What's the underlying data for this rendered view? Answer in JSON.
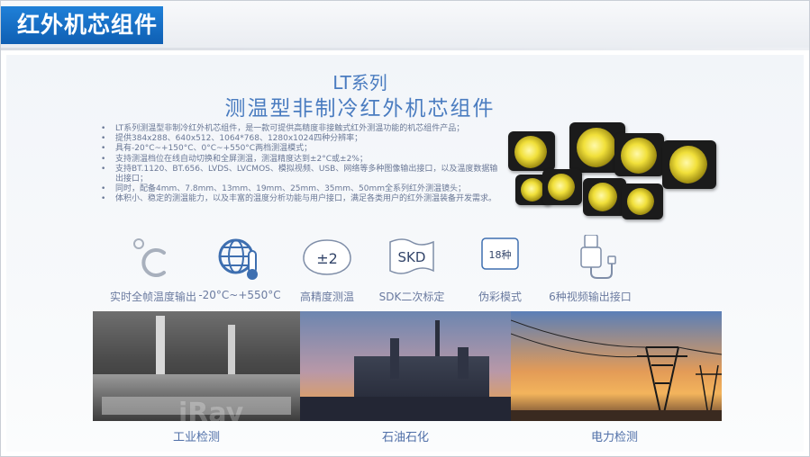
{
  "header": {
    "title": "红外机芯组件"
  },
  "heading": {
    "line1": "LT系列",
    "line2": "测温型非制冷红外机芯组件"
  },
  "bullets": [
    "LT系列测温型非制冷红外机芯组件，是一款可提供高精度非接触式红外测温功能的机芯组件产品；",
    "提供384x288、640x512、1064*768、1280x1024四种分辨率；",
    "具有-20°C~+150°C、0°C~+550°C两档测温模式；",
    "支持测温档位在线自动切换和全屏测温，测温精度达到±2°C或±2%；",
    "支持BT.1120、BT.656、LVDS、LVCMOS、模拟视频、USB、网络等多种图像输出接口，以及温度数据输出接口；",
    "同时，配备4mm、7.8mm、13mm、19mm、25mm、35mm、50mm全系列红外测温镜头；",
    "体积小、稳定的测温能力，以及丰富的温度分析功能与用户接口，满足各类用户的红外测温装备开发需求。"
  ],
  "features": [
    {
      "icon": "thermometer-c-icon",
      "label": "实时全帧温度输出"
    },
    {
      "icon": "globe-thermometer-icon",
      "label": "-20°C~+550°C"
    },
    {
      "icon": "accuracy-bubble-icon",
      "icon_text": "±2",
      "label": "高精度测温"
    },
    {
      "icon": "sdk-flag-icon",
      "icon_text": "SKD",
      "label": "SDK二次标定"
    },
    {
      "icon": "palette-badge-icon",
      "icon_text": "18种",
      "label": "伪彩模式"
    },
    {
      "icon": "usb-plug-icon",
      "label": "6种视频输出接口"
    }
  ],
  "applications": [
    {
      "label": "工业检测",
      "watermark": "iRay"
    },
    {
      "label": "石油石化"
    },
    {
      "label": "电力检测"
    }
  ],
  "colors": {
    "brand_blue": "#1a6fc4",
    "heading_blue": "#4a7cc0",
    "lens_yellow": "#f1e03a"
  }
}
